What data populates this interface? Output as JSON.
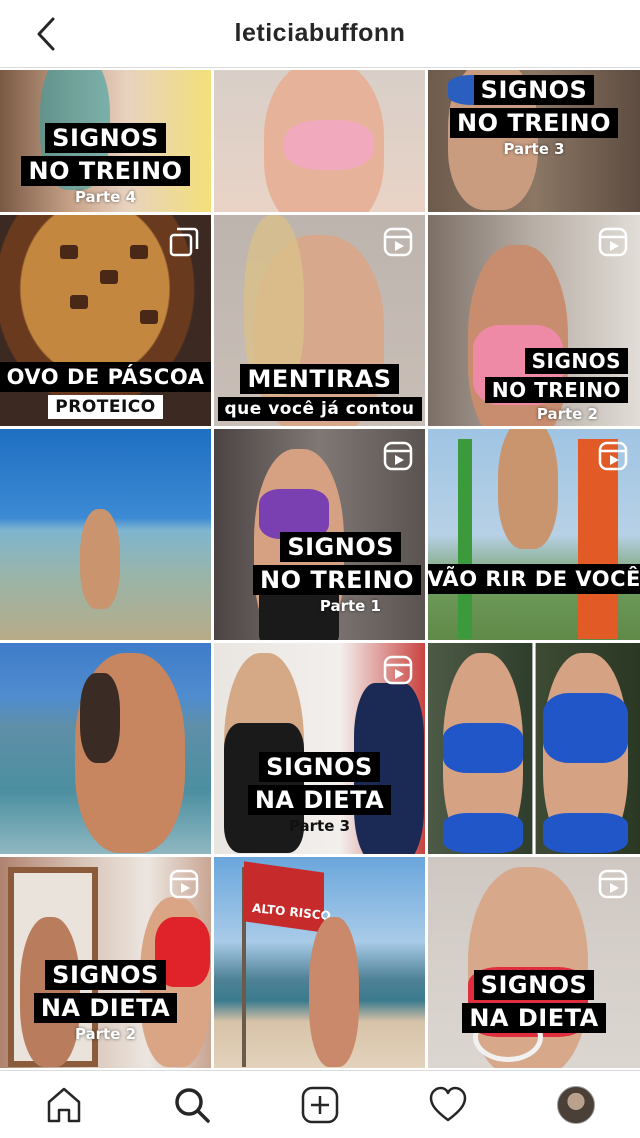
{
  "header": {
    "title": "leticiabuffonn",
    "back_icon": "chevron-left-icon"
  },
  "posts": [
    {
      "lines": [
        "SIGNOS",
        "NO TREINO"
      ],
      "part": "Parte 4",
      "badge": null
    },
    {
      "lines": [],
      "part": "",
      "badge": null
    },
    {
      "lines": [
        "SIGNOS",
        "NO TREINO"
      ],
      "part": "Parte 3",
      "badge": null
    },
    {
      "lines": [
        "OVO DE PÁSCOA"
      ],
      "sub": "PROTEICO",
      "part": "",
      "badge": "carousel-icon"
    },
    {
      "lines": [
        "MENTIRAS"
      ],
      "sub": "que você já contou",
      "part": "",
      "badge": "reels-icon"
    },
    {
      "lines": [
        "SIGNOS",
        "NO TREINO"
      ],
      "part": "Parte 2",
      "badge": "reels-icon"
    },
    {
      "lines": [],
      "part": "",
      "badge": null
    },
    {
      "lines": [
        "SIGNOS",
        "NO TREINO"
      ],
      "part": "Parte 1",
      "badge": "reels-icon"
    },
    {
      "lines": [
        "VÃO RIR DE VOCÊ"
      ],
      "part": "",
      "badge": "reels-icon"
    },
    {
      "lines": [],
      "part": "",
      "badge": null
    },
    {
      "lines": [
        "SIGNOS",
        "NA DIETA"
      ],
      "part": "Parte 3",
      "badge": "reels-icon"
    },
    {
      "lines": [],
      "part": "",
      "badge": null
    },
    {
      "lines": [
        "SIGNOS",
        "NA DIETA"
      ],
      "part": "Parte 2",
      "badge": "reels-icon"
    },
    {
      "lines": [],
      "part": "",
      "badge": null,
      "flag_text": "ALTO RISCO"
    },
    {
      "lines": [
        "SIGNOS",
        "NA DIETA"
      ],
      "part": "",
      "badge": "reels-icon"
    }
  ],
  "nav": {
    "items": [
      "home-icon",
      "search-icon",
      "new-post-icon",
      "activity-heart-icon",
      "profile-avatar"
    ]
  },
  "colors": {
    "border": "#dbdbdb",
    "text": "#262626",
    "caption_bg": "#000000"
  }
}
